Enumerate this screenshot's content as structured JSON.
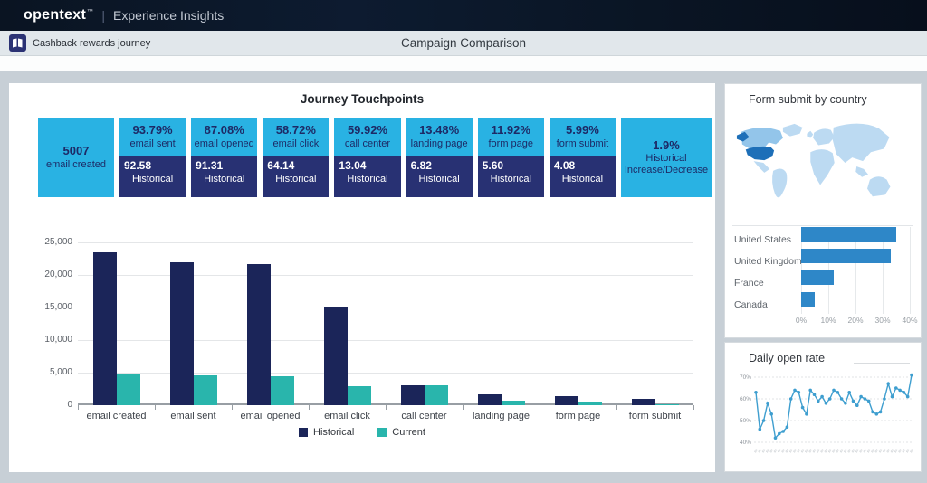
{
  "header": {
    "brand": "opentext",
    "trademark": "™",
    "divider": "|",
    "product": "Experience Insights"
  },
  "subheader": {
    "journey_label": "Cashback rewards journey",
    "title": "Campaign Comparison"
  },
  "main": {
    "title": "Journey Touchpoints",
    "historical_label": "Historical",
    "tiles": [
      {
        "style": "solid",
        "value": "5007",
        "label": "email created"
      },
      {
        "style": "split",
        "value": "93.79%",
        "label": "email sent",
        "historical_value": "92.58"
      },
      {
        "style": "split",
        "value": "87.08%",
        "label": "email opened",
        "historical_value": "91.31"
      },
      {
        "style": "split",
        "value": "58.72%",
        "label": "email click",
        "historical_value": "64.14"
      },
      {
        "style": "split",
        "value": "59.92%",
        "label": "call center",
        "historical_value": "13.04"
      },
      {
        "style": "split",
        "value": "13.48%",
        "label": "landing page",
        "historical_value": "6.82"
      },
      {
        "style": "split",
        "value": "11.92%",
        "label": "form page",
        "historical_value": "5.60"
      },
      {
        "style": "split",
        "value": "5.99%",
        "label": "form submit",
        "historical_value": "4.08"
      },
      {
        "style": "solid",
        "value": "1.9%",
        "label": "Historical Increase/Decrease"
      }
    ],
    "legend": [
      {
        "label": "Historical",
        "color": "#1b2559"
      },
      {
        "label": "Current",
        "color": "#29b5ac"
      }
    ]
  },
  "panels": {
    "country_title": "Form submit by country",
    "open_rate_title": "Daily open rate"
  },
  "chart_data": [
    {
      "id": "journey_touchpoints",
      "type": "bar",
      "title": "Journey Touchpoints",
      "categories": [
        "email created",
        "email sent",
        "email opened",
        "email click",
        "call center",
        "landing page",
        "form page",
        "form submit"
      ],
      "series": [
        {
          "name": "Historical",
          "color": "#1b2559",
          "values": [
            23500,
            21900,
            21600,
            15200,
            3000,
            1600,
            1350,
            1000
          ]
        },
        {
          "name": "Current",
          "color": "#29b5ac",
          "values": [
            4900,
            4600,
            4400,
            2900,
            3000,
            700,
            600,
            200
          ]
        }
      ],
      "ylim": [
        0,
        25000
      ],
      "ytick_step": 5000,
      "ytick_labels": [
        "0",
        "5,000",
        "10,000",
        "15,000",
        "20,000",
        "25,000"
      ],
      "grid": true,
      "legend_position": "bottom"
    },
    {
      "id": "form_submit_by_country",
      "type": "bar",
      "orientation": "horizontal",
      "title": "Form submit by country",
      "categories": [
        "United States",
        "United Kingdom",
        "France",
        "Canada"
      ],
      "values": [
        35,
        33,
        12,
        5
      ],
      "xlim": [
        0,
        40
      ],
      "xtick_labels": [
        "0%",
        "10%",
        "20%",
        "30%",
        "40%"
      ],
      "bar_color": "#2e87c8",
      "map_highlight": "United States"
    },
    {
      "id": "daily_open_rate",
      "type": "line",
      "title": "Daily open rate",
      "values": [
        63,
        46,
        50,
        58,
        53,
        42,
        44,
        45,
        47,
        60,
        64,
        63,
        56,
        53,
        64,
        62,
        59,
        61,
        58,
        60,
        64,
        63,
        60,
        58,
        63,
        59,
        57,
        61,
        60,
        59,
        54,
        53,
        54,
        60,
        67,
        61,
        65,
        64,
        63,
        61,
        71
      ],
      "ylim": [
        38,
        74
      ],
      "yticks": [
        40,
        50,
        60,
        70
      ],
      "ytick_labels": [
        "40%",
        "50%",
        "60%",
        "70%"
      ],
      "line_color": "#3e9ecf",
      "x_labels_legible": false,
      "x_tick_placeholder": "##"
    }
  ],
  "colors": {
    "accent_cyan": "#29b2e3",
    "tile_navy": "#283173",
    "tile_text_navy": "#1d2a66",
    "historical_bar": "#1b2559",
    "current_bar": "#29b5ac",
    "country_bar": "#2e87c8",
    "line_blue": "#3e9ecf",
    "map_light": "#bcdaf2",
    "map_mid": "#93c5ea",
    "map_dark": "#1d6fb8"
  }
}
